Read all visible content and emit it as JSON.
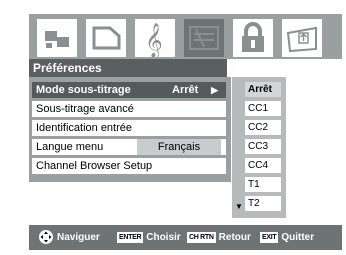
{
  "menu": {
    "title": "Préférences",
    "items": [
      {
        "label": "Mode sous-titrage",
        "value": "Arrêt"
      },
      {
        "label": "Sous-titrage avancé"
      },
      {
        "label": "Identification entrée"
      },
      {
        "label": "Langue menu",
        "value": "Français"
      },
      {
        "label": "Channel Browser Setup"
      }
    ]
  },
  "options": [
    "Arrêt",
    "CC1",
    "CC2",
    "CC3",
    "CC4",
    "T1",
    "T2"
  ],
  "footer": {
    "navigate": "Naviguer",
    "enter_key": "ENTER",
    "choose": "Choisir",
    "chrtn_key": "CH RTN",
    "back": "Retour",
    "exit_key": "EXIT",
    "quit": "Quitter"
  },
  "icons": [
    "picture-icon",
    "screen-icon",
    "audio-icon",
    "preferences-icon",
    "lock-icon",
    "setup-icon"
  ],
  "colors": {
    "panel_dark": "#5a6060",
    "panel_mid": "#9aa0a0",
    "footer": "#6e7474"
  }
}
